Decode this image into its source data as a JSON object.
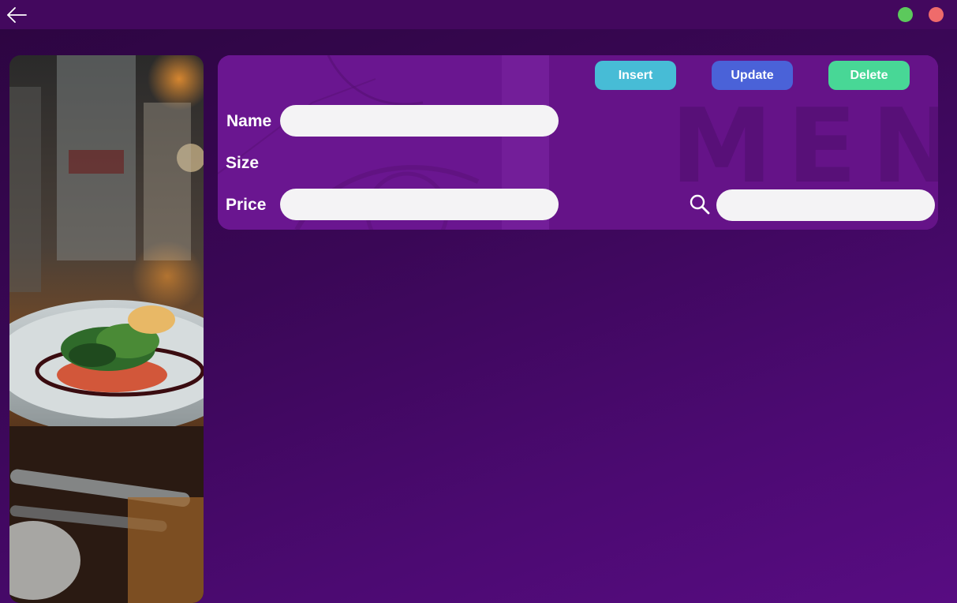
{
  "titlebar": {
    "back_icon": "arrow-left-icon",
    "window_controls": [
      {
        "name": "maximize",
        "color": "#5cc95c"
      },
      {
        "name": "close",
        "color": "#ef6b6b"
      }
    ]
  },
  "panel": {
    "background_text": "MENU"
  },
  "toolbar": {
    "insert_label": "Insert",
    "update_label": "Update",
    "delete_label": "Delete"
  },
  "form": {
    "name_label": "Name",
    "name_value": "",
    "size_label": "Size",
    "price_label": "Price",
    "price_value": "",
    "search_icon": "search-icon",
    "search_value": ""
  },
  "colors": {
    "insert": "#47bcd6",
    "update": "#4a62d8",
    "delete": "#48d796",
    "panel": "#6a1690"
  }
}
